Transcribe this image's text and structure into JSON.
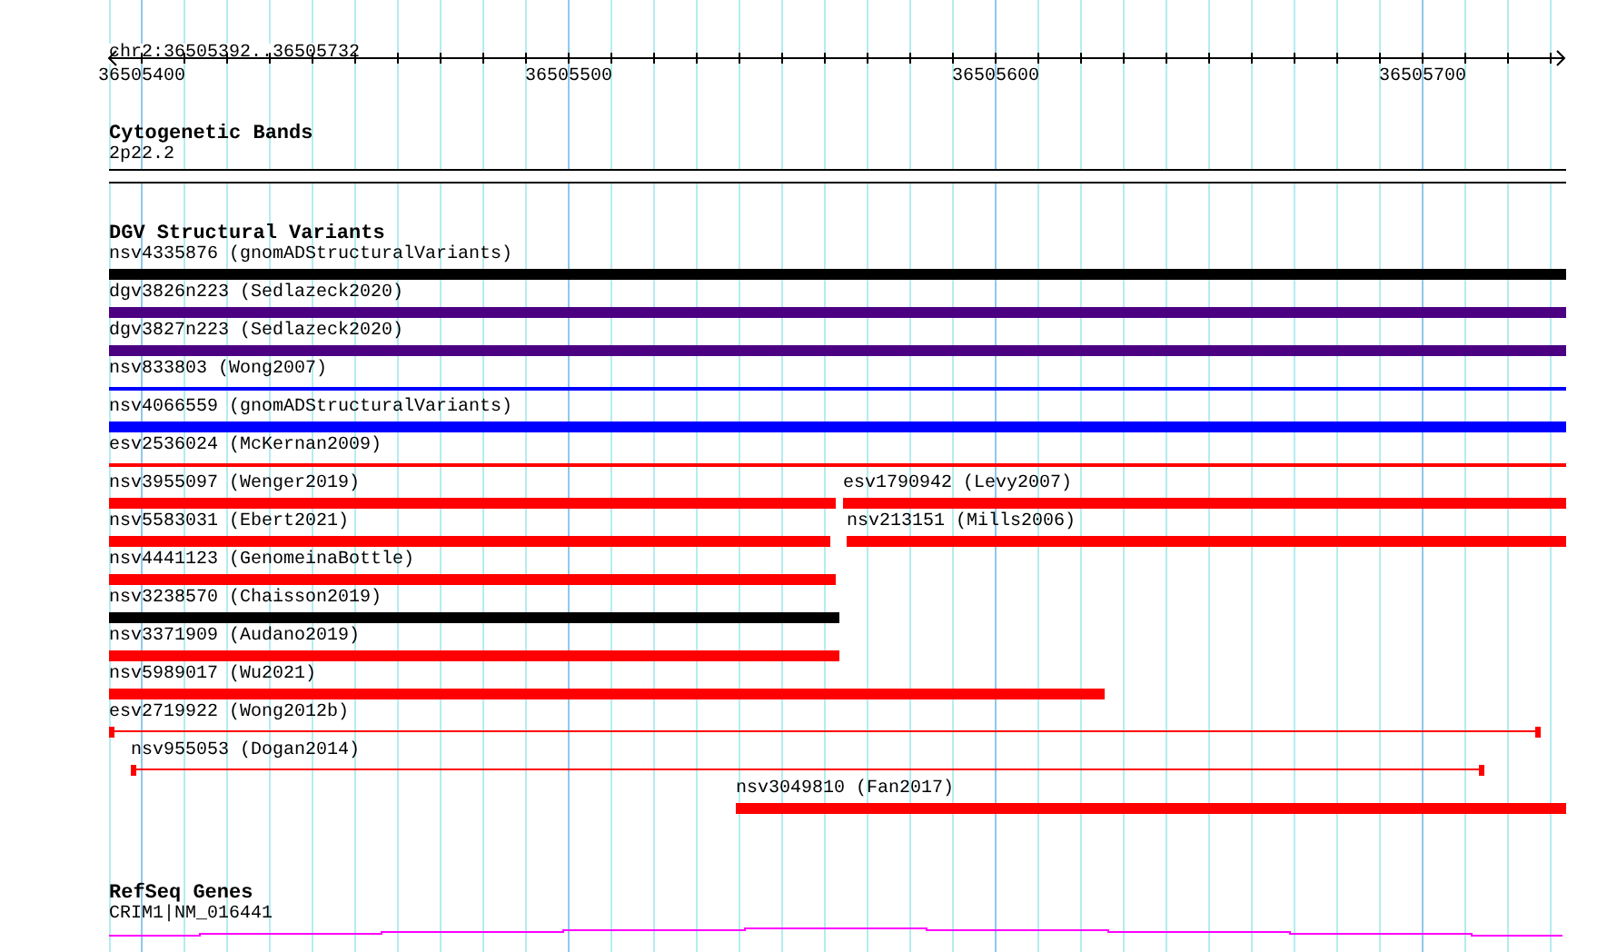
{
  "position": "chr2:36505392..36505732",
  "ruler": {
    "ticks": [
      "36505400",
      "36505500",
      "36505600",
      "36505700"
    ]
  },
  "cytogenetic_bands": {
    "title": "Cytogenetic Bands",
    "band": "2p22.2"
  },
  "dgv": {
    "title": "DGV Structural Variants",
    "rows": [
      {
        "features": [
          {
            "label": "nsv4335876 (gnomADStructuralVariants)",
            "kind": "thick",
            "color": "#000000"
          }
        ]
      },
      {
        "features": [
          {
            "label": "dgv3826n223 (Sedlazeck2020)",
            "kind": "thick",
            "color": "#4b0082"
          }
        ]
      },
      {
        "features": [
          {
            "label": "dgv3827n223 (Sedlazeck2020)",
            "kind": "thick",
            "color": "#4b0082"
          }
        ]
      },
      {
        "features": [
          {
            "label": "nsv833803 (Wong2007)",
            "kind": "thin",
            "color": "#0000ff"
          }
        ]
      },
      {
        "features": [
          {
            "label": "nsv4066559 (gnomADStructuralVariants)",
            "kind": "thick",
            "color": "#0000ff"
          }
        ]
      },
      {
        "features": [
          {
            "label": "esv2536024 (McKernan2009)",
            "kind": "thin",
            "color": "#ff0000"
          }
        ]
      },
      {
        "features": [
          {
            "label": "nsv3955097 (Wenger2019)",
            "kind": "thick",
            "color": "#ff0000"
          },
          {
            "label": "esv1790942 (Levy2007)",
            "kind": "thick",
            "color": "#ff0000"
          }
        ]
      },
      {
        "features": [
          {
            "label": "nsv5583031 (Ebert2021)",
            "kind": "thick",
            "color": "#ff0000"
          },
          {
            "label": "nsv213151 (Mills2006)",
            "kind": "thick",
            "color": "#ff0000"
          }
        ]
      },
      {
        "features": [
          {
            "label": "nsv4441123 (GenomeinaBottle)",
            "kind": "thick",
            "color": "#ff0000"
          }
        ]
      },
      {
        "features": [
          {
            "label": "nsv3238570 (Chaisson2019)",
            "kind": "thick",
            "color": "#000000"
          }
        ]
      },
      {
        "features": [
          {
            "label": "nsv3371909 (Audano2019)",
            "kind": "thick",
            "color": "#ff0000"
          }
        ]
      },
      {
        "features": [
          {
            "label": "nsv5989017 (Wu2021)",
            "kind": "thick",
            "color": "#ff0000"
          }
        ]
      },
      {
        "features": [
          {
            "label": "esv2719922 (Wong2012b)",
            "kind": "capped",
            "color": "#ff0000"
          }
        ]
      },
      {
        "features": [
          {
            "label": "nsv955053 (Dogan2014)",
            "kind": "capped",
            "color": "#ff0000"
          }
        ]
      },
      {
        "features": [
          {
            "label": "nsv3049810 (Fan2017)",
            "kind": "thick",
            "color": "#ff0000"
          }
        ]
      }
    ]
  },
  "refseq_genes": {
    "title": "RefSeq Genes",
    "gene": "CRIM1|NM_016441"
  }
}
